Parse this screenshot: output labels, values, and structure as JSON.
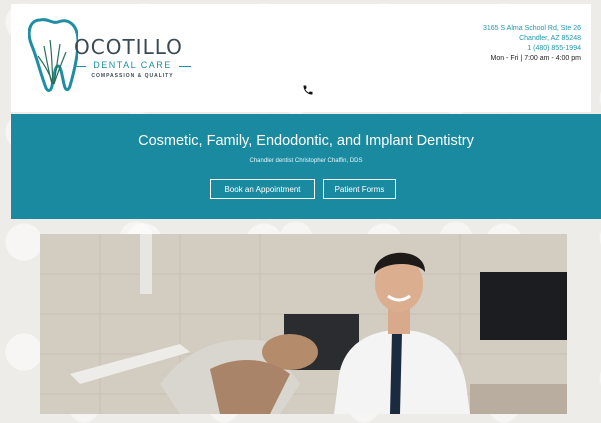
{
  "brand": {
    "name": "OCOTILLO",
    "subtitle": "DENTAL CARE",
    "tagline": "COMPASSION & QUALITY"
  },
  "contact": {
    "address_line1": "3165 S Alma School Rd, Ste 26",
    "address_line2": "Chandler, AZ 85248",
    "phone": "1 (480) 855-1994",
    "hours": "Mon - Fri  |  7:00 am - 4:00 pm"
  },
  "banner": {
    "title": "Cosmetic, Family, Endodontic, and Implant Dentistry",
    "subtitle": "Chandler dentist Christopher Chaffin, DDS",
    "book_label": "Book an Appointment",
    "forms_label": "Patient Forms"
  },
  "colors": {
    "teal": "#1a8aa0",
    "link": "#1f98ad"
  },
  "icons": [
    "tooth-logo-icon",
    "phone-icon"
  ]
}
